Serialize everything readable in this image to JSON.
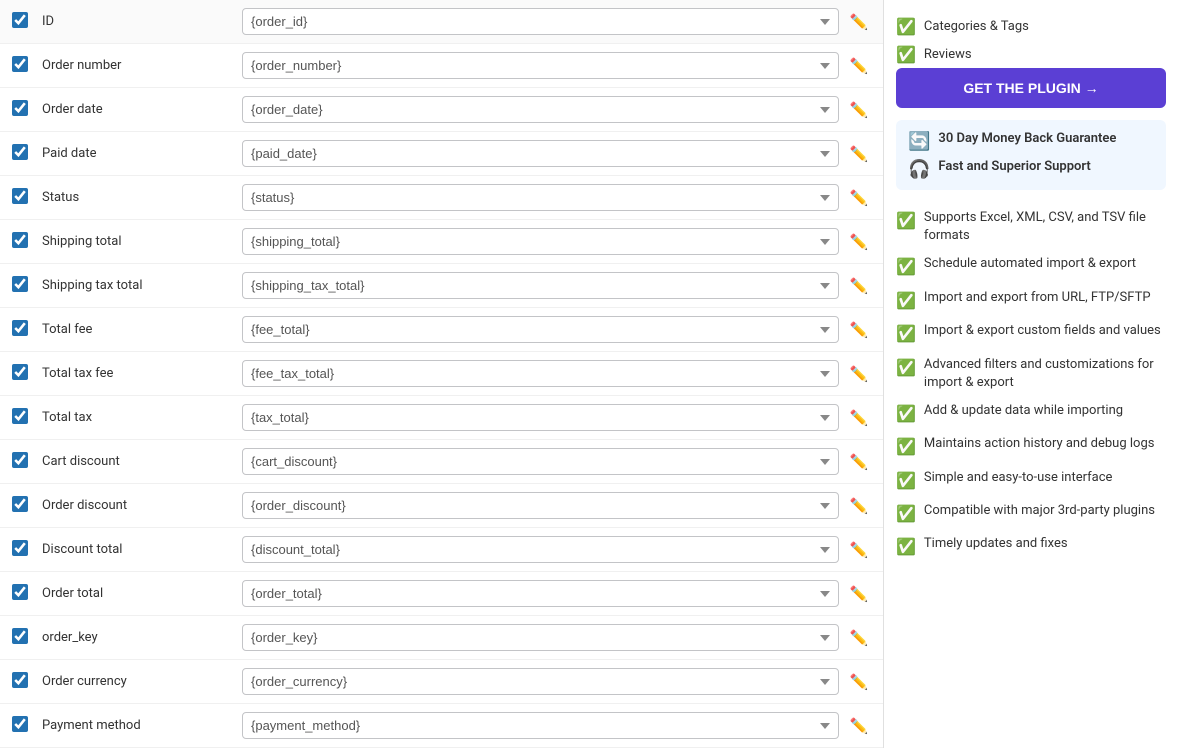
{
  "rows": [
    {
      "id": "row-id",
      "label": "ID",
      "value": "{order_id}",
      "checked": true
    },
    {
      "id": "row-order-number",
      "label": "Order number",
      "value": "{order_number}",
      "checked": true
    },
    {
      "id": "row-order-date",
      "label": "Order date",
      "value": "{order_date}",
      "checked": true
    },
    {
      "id": "row-paid-date",
      "label": "Paid date",
      "value": "{paid_date}",
      "checked": true
    },
    {
      "id": "row-status",
      "label": "Status",
      "value": "{status}",
      "checked": true
    },
    {
      "id": "row-shipping-total",
      "label": "Shipping total",
      "value": "{shipping_total}",
      "checked": true
    },
    {
      "id": "row-shipping-tax-total",
      "label": "Shipping tax total",
      "value": "{shipping_tax_total}",
      "checked": true
    },
    {
      "id": "row-total-fee",
      "label": "Total fee",
      "value": "{fee_total}",
      "checked": true
    },
    {
      "id": "row-total-tax-fee",
      "label": "Total tax fee",
      "value": "{fee_tax_total}",
      "checked": true
    },
    {
      "id": "row-total-tax",
      "label": "Total tax",
      "value": "{tax_total}",
      "checked": true
    },
    {
      "id": "row-cart-discount",
      "label": "Cart discount",
      "value": "{cart_discount}",
      "checked": true
    },
    {
      "id": "row-order-discount",
      "label": "Order discount",
      "value": "{order_discount}",
      "checked": true
    },
    {
      "id": "row-discount-total",
      "label": "Discount total",
      "value": "{discount_total}",
      "checked": true
    },
    {
      "id": "row-order-total",
      "label": "Order total",
      "value": "{order_total}",
      "checked": true
    },
    {
      "id": "row-order-key",
      "label": "order_key",
      "value": "{order_key}",
      "checked": true
    },
    {
      "id": "row-order-currency",
      "label": "Order currency",
      "value": "{order_currency}",
      "checked": true
    },
    {
      "id": "row-payment-method",
      "label": "Payment method",
      "value": "{payment_method}",
      "checked": true
    }
  ],
  "sidebar": {
    "get_plugin_label": "GET THE PLUGIN →",
    "guarantee": {
      "money_back": "30 Day Money Back Guarantee",
      "support": "Fast and Superior Support"
    },
    "categories_tags": "Categories & Tags",
    "reviews": "Reviews",
    "features": [
      "Supports Excel, XML, CSV, and TSV file formats",
      "Schedule automated import & export",
      "Import and export from URL, FTP/SFTP",
      "Import & export custom fields and values",
      "Advanced filters and customizations for import & export",
      "Add & update data while importing",
      "Maintains action history and debug logs",
      "Simple and easy-to-use interface",
      "Compatible with major 3rd-party plugins",
      "Timely updates and fixes"
    ]
  }
}
